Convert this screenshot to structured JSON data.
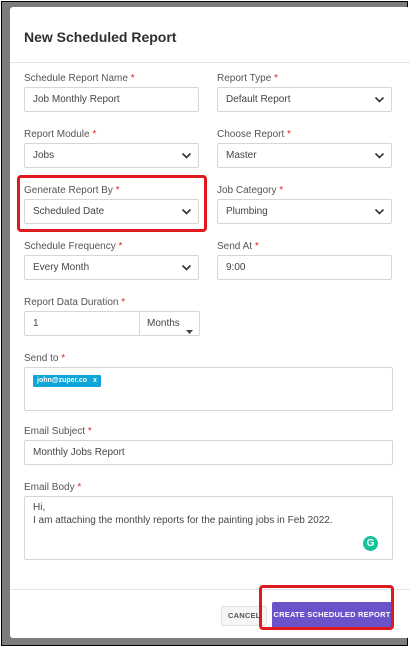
{
  "modal": {
    "title": "New Scheduled Report"
  },
  "fields": {
    "schedule_report_name": {
      "label": "Schedule Report Name",
      "required": "*",
      "value": "Job Monthly Report"
    },
    "report_type": {
      "label": "Report Type",
      "required": "*",
      "value": "Default Report"
    },
    "report_module": {
      "label": "Report Module",
      "required": "*",
      "value": "Jobs"
    },
    "choose_report": {
      "label": "Choose Report",
      "required": "*",
      "value": "Master"
    },
    "generate_report_by": {
      "label": "Generate Report By",
      "required": "*",
      "value": "Scheduled Date"
    },
    "job_category": {
      "label": "Job Category",
      "required": "*",
      "value": "Plumbing"
    },
    "schedule_frequency": {
      "label": "Schedule Frequency",
      "required": "*",
      "value": "Every Month"
    },
    "send_at": {
      "label": "Send At",
      "required": "*",
      "value": "9:00"
    },
    "report_data_duration": {
      "label": "Report Data Duration",
      "required": "*",
      "value": "1",
      "unit": "Months"
    },
    "send_to": {
      "label": "Send to",
      "required": "*",
      "tags": [
        {
          "email": "john@zuper.co",
          "remove": "x"
        }
      ]
    },
    "email_subject": {
      "label": "Email Subject",
      "required": "*",
      "value": "Monthly Jobs Report"
    },
    "email_body": {
      "label": "Email Body",
      "required": "*",
      "lines": [
        "Hi,",
        "I am attaching the monthly reports for the painting jobs in Feb 2022."
      ],
      "grammarly_glyph": "G"
    }
  },
  "footer": {
    "cancel_label": "CANCEL",
    "create_label": "CREATE SCHEDULED REPORT"
  },
  "colors": {
    "highlight": "#e0191f",
    "primary_button": "#6a52c8",
    "tag": "#0ea5d8",
    "required": "#e02424"
  },
  "icons": {
    "dropdown": "chevron-down-icon",
    "unit_dropdown": "caret-down-icon",
    "grammarly": "grammarly-icon"
  }
}
